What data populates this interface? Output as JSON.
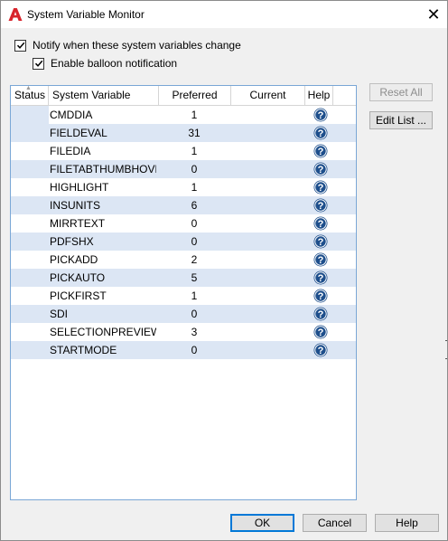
{
  "window": {
    "title": "System Variable Monitor",
    "close_glyph": "✕",
    "app_icon": "autocad-icon",
    "brand_color": "#d8242c"
  },
  "options": {
    "notify_label": "Notify when these system variables change",
    "notify_checked": true,
    "balloon_label": "Enable balloon notification",
    "balloon_checked": true
  },
  "table": {
    "columns": [
      "Status",
      "System Variable",
      "Preferred",
      "Current",
      "Help"
    ],
    "sorted_column": "Status",
    "rows": [
      {
        "variable": "CMDDIA",
        "preferred": "1",
        "current": ""
      },
      {
        "variable": "FIELDEVAL",
        "preferred": "31",
        "current": ""
      },
      {
        "variable": "FILEDIA",
        "preferred": "1",
        "current": ""
      },
      {
        "variable": "FILETABTHUMBHOVER",
        "preferred": "0",
        "current": ""
      },
      {
        "variable": "HIGHLIGHT",
        "preferred": "1",
        "current": ""
      },
      {
        "variable": "INSUNITS",
        "preferred": "6",
        "current": ""
      },
      {
        "variable": "MIRRTEXT",
        "preferred": "0",
        "current": ""
      },
      {
        "variable": "PDFSHX",
        "preferred": "0",
        "current": ""
      },
      {
        "variable": "PICKADD",
        "preferred": "2",
        "current": ""
      },
      {
        "variable": "PICKAUTO",
        "preferred": "5",
        "current": ""
      },
      {
        "variable": "PICKFIRST",
        "preferred": "1",
        "current": ""
      },
      {
        "variable": "SDI",
        "preferred": "0",
        "current": ""
      },
      {
        "variable": "SELECTIONPREVIEW",
        "preferred": "3",
        "current": ""
      },
      {
        "variable": "STARTMODE",
        "preferred": "0",
        "current": ""
      }
    ]
  },
  "side_buttons": {
    "reset_all": "Reset All",
    "edit_list": "Edit List ..."
  },
  "footer": {
    "ok": "OK",
    "cancel": "Cancel",
    "help": "Help"
  },
  "colors": {
    "row_alt": "#dce6f4",
    "help_icon": "#1e4f8c",
    "accent": "#0078d7"
  }
}
